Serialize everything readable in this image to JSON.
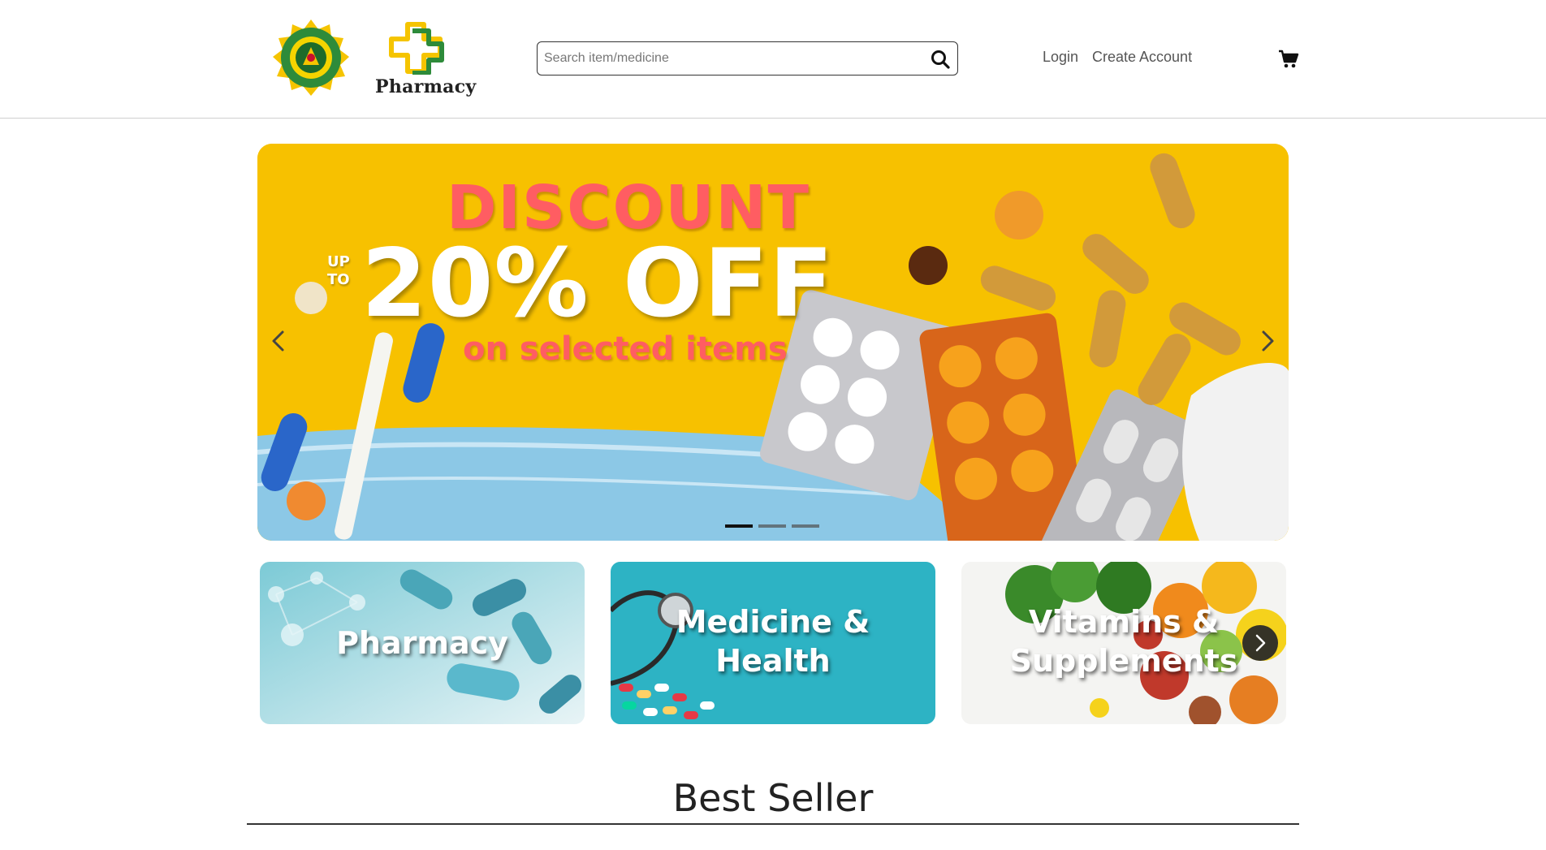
{
  "header": {
    "seal_icon": "government-seal-logo",
    "logo_icon": "green-cross-logo",
    "logo_text": "Pharmacy",
    "search": {
      "placeholder": "Search item/medicine",
      "value": "",
      "button_icon": "search-icon"
    },
    "nav": {
      "login": "Login",
      "create_account": "Create Account"
    },
    "cart_icon": "cart-icon"
  },
  "carousel": {
    "slide": {
      "headline": "DISCOUNT",
      "prefix_line1": "UP",
      "prefix_line2": "TO",
      "offer": "20% OFF",
      "subline": "on selected items"
    },
    "prev_icon": "chevron-left-icon",
    "next_icon": "chevron-right-icon",
    "slide_count": 3,
    "active_index": 0
  },
  "categories": {
    "items": [
      {
        "label": "Pharmacy"
      },
      {
        "label_line1": "Medicine &",
        "label_line2": "Health"
      },
      {
        "label_line1": "Vitamins &",
        "label_line2": "Supplements"
      }
    ],
    "next_icon": "chevron-right-icon"
  },
  "best_seller": {
    "title": "Best Seller"
  },
  "colors": {
    "banner_yellow": "#f7c100",
    "discount_red": "#ff5d62",
    "logo_green": "#2e8b3a",
    "logo_gold": "#f5c400",
    "pharmacy_card": "#8fd3dc",
    "medicine_card": "#2db3c4"
  }
}
